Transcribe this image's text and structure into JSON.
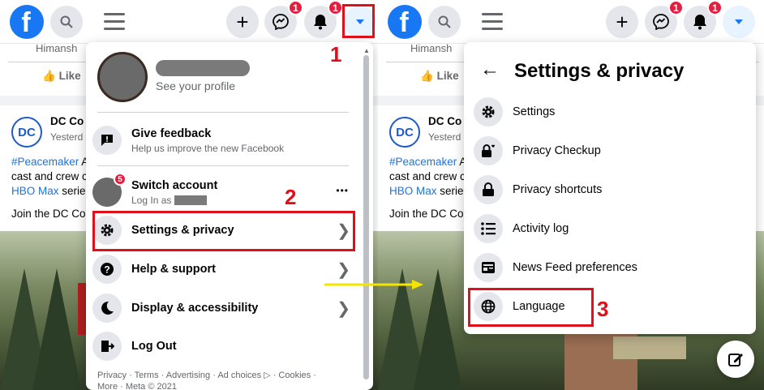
{
  "topbar": {
    "logo": "f",
    "badge_messenger": "1",
    "badge_notifications": "1"
  },
  "feed": {
    "name_partial": "Himansh",
    "like": "Like",
    "page_name": "DC Co",
    "time": "Yesterd",
    "line1_link": "#Peacemaker",
    "line1_rest": " A",
    "line2": "cast and crew c",
    "line3_link": "HBO Max",
    "line3_rest": " serie",
    "line4": "Join the DC Co",
    "dc_logo": "DC"
  },
  "menu": {
    "profile_sub": "See your profile",
    "items": [
      {
        "title": "Give feedback",
        "sub": "Help us improve the new Facebook",
        "icon": "feedback-icon"
      },
      {
        "title": "Switch account",
        "sub": "Log In as",
        "badge": "5",
        "icon": "avatar"
      },
      {
        "title": "Settings & privacy",
        "icon": "gear-icon"
      },
      {
        "title": "Help & support",
        "icon": "question-icon"
      },
      {
        "title": "Display & accessibility",
        "icon": "moon-icon"
      },
      {
        "title": "Log Out",
        "icon": "logout-icon"
      }
    ],
    "footer_line1": "Privacy · Terms · Advertising · Ad choices ▷ · Cookies ·",
    "footer_line2": "More · Meta © 2021",
    "more_dots": "•••"
  },
  "settings": {
    "title": "Settings & privacy",
    "items": [
      {
        "title": "Settings",
        "icon": "gear-icon"
      },
      {
        "title": "Privacy Checkup",
        "icon": "lock-heart-icon"
      },
      {
        "title": "Privacy shortcuts",
        "icon": "lock-icon"
      },
      {
        "title": "Activity log",
        "icon": "list-icon"
      },
      {
        "title": "News Feed preferences",
        "icon": "feed-icon"
      },
      {
        "title": "Language",
        "icon": "globe-icon"
      }
    ]
  },
  "annotations": {
    "step1": "1",
    "step2": "2",
    "step3": "3"
  },
  "colors": {
    "brand": "#1877f2",
    "annotation_red": "#e0101a",
    "arrow_yellow": "#f5e400"
  }
}
